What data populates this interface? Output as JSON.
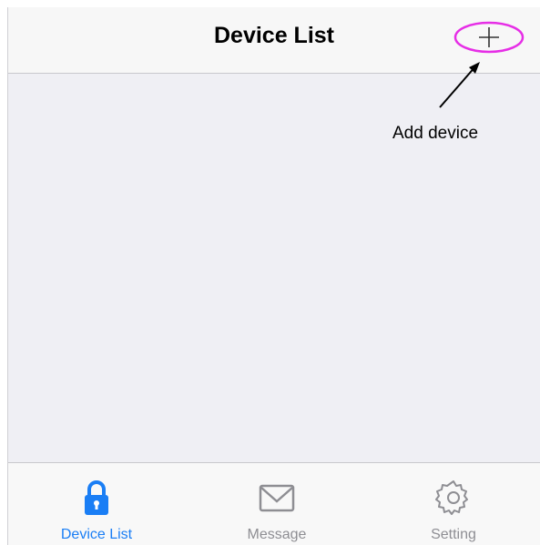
{
  "navbar": {
    "title": "Device List",
    "add_icon": "plus-icon"
  },
  "annotation": {
    "text": "Add device",
    "highlight_color": "#e62ee6"
  },
  "tabbar": {
    "active_color": "#1a7ef5",
    "inactive_color": "#8e8e93",
    "tabs": [
      {
        "label": "Device List",
        "icon": "lock-icon",
        "active": true
      },
      {
        "label": "Message",
        "icon": "envelope-icon",
        "active": false
      },
      {
        "label": "Setting",
        "icon": "gear-icon",
        "active": false
      }
    ]
  }
}
